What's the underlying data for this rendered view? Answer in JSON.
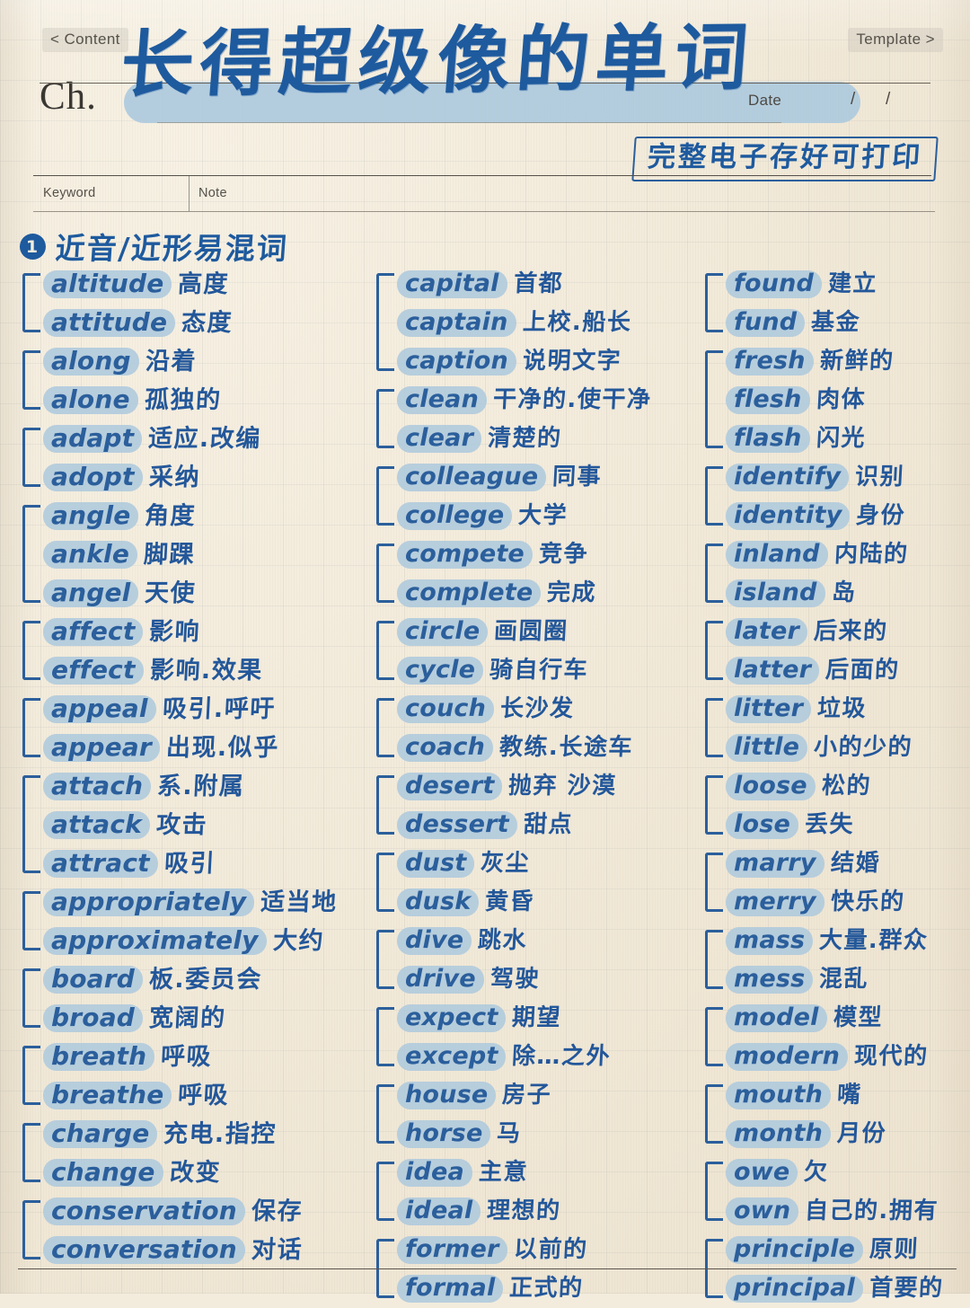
{
  "header": {
    "nav_prev": "< Content",
    "nav_next": "Template >",
    "chapter_label": "Ch.",
    "title": "长得超级像的单词",
    "date_label": "Date",
    "date_sep_1": "/",
    "date_sep_2": "/",
    "stamp": "完整电子存好可打印",
    "table_headers": {
      "keyword": "Keyword",
      "note": "Note"
    }
  },
  "section": {
    "number": "❶",
    "number_plain": "1",
    "heading": "近音/近形易混词"
  },
  "colors": {
    "paper": "#f3ecdd",
    "ink_blue": "#2b5f9c",
    "title_blue": "#1e5a9e",
    "highlight": "#aecadd",
    "rule_gray": "#55504a"
  },
  "columns": [
    {
      "id": "col-1",
      "groups": [
        {
          "items": [
            {
              "word": "altitude",
              "zh": "高度"
            },
            {
              "word": "attitude",
              "zh": "态度"
            }
          ]
        },
        {
          "items": [
            {
              "word": "along",
              "zh": "沿着"
            },
            {
              "word": "alone",
              "zh": "孤独的"
            }
          ]
        },
        {
          "items": [
            {
              "word": "adapt",
              "zh": "适应.改编"
            },
            {
              "word": "adopt",
              "zh": "采纳"
            }
          ]
        },
        {
          "items": [
            {
              "word": "angle",
              "zh": "角度"
            },
            {
              "word": "ankle",
              "zh": "脚踝"
            },
            {
              "word": "angel",
              "zh": "天使"
            }
          ]
        },
        {
          "items": [
            {
              "word": "affect",
              "zh": "影响"
            },
            {
              "word": "effect",
              "zh": "影响.效果"
            }
          ]
        },
        {
          "items": [
            {
              "word": "appeal",
              "zh": "吸引.呼吁"
            },
            {
              "word": "appear",
              "zh": "出现.似乎"
            }
          ]
        },
        {
          "items": [
            {
              "word": "attach",
              "zh": "系.附属"
            },
            {
              "word": "attack",
              "zh": "攻击"
            },
            {
              "word": "attract",
              "zh": "吸引"
            }
          ]
        },
        {
          "items": [
            {
              "word": "appropriately",
              "zh": "适当地"
            },
            {
              "word": "approximately",
              "zh": "大约"
            }
          ]
        },
        {
          "items": [
            {
              "word": "board",
              "zh": "板.委员会"
            },
            {
              "word": "broad",
              "zh": "宽阔的"
            }
          ]
        },
        {
          "items": [
            {
              "word": "breath",
              "zh": "呼吸"
            },
            {
              "word": "breathe",
              "zh": "呼吸"
            }
          ]
        },
        {
          "items": [
            {
              "word": "charge",
              "zh": "充电.指控"
            },
            {
              "word": "change",
              "zh": "改变"
            }
          ]
        },
        {
          "items": [
            {
              "word": "conservation",
              "zh": "保存"
            },
            {
              "word": "conversation",
              "zh": "对话"
            }
          ]
        }
      ]
    },
    {
      "id": "col-2",
      "groups": [
        {
          "items": [
            {
              "word": "capital",
              "zh": "首都"
            },
            {
              "word": "captain",
              "zh": "上校.船长"
            },
            {
              "word": "caption",
              "zh": "说明文字"
            }
          ]
        },
        {
          "items": [
            {
              "word": "clean",
              "zh": "干净的.使干净"
            },
            {
              "word": "clear",
              "zh": "清楚的"
            }
          ]
        },
        {
          "items": [
            {
              "word": "colleague",
              "zh": "同事"
            },
            {
              "word": "college",
              "zh": "大学"
            }
          ]
        },
        {
          "items": [
            {
              "word": "compete",
              "zh": "竞争"
            },
            {
              "word": "complete",
              "zh": "完成"
            }
          ]
        },
        {
          "items": [
            {
              "word": "circle",
              "zh": "画圆圈"
            },
            {
              "word": "cycle",
              "zh": "骑自行车"
            }
          ]
        },
        {
          "items": [
            {
              "word": "couch",
              "zh": "长沙发"
            },
            {
              "word": "coach",
              "zh": "教练.长途车"
            }
          ]
        },
        {
          "items": [
            {
              "word": "desert",
              "zh": "抛弃 沙漠"
            },
            {
              "word": "dessert",
              "zh": "甜点"
            }
          ]
        },
        {
          "items": [
            {
              "word": "dust",
              "zh": "灰尘"
            },
            {
              "word": "dusk",
              "zh": "黄昏"
            }
          ]
        },
        {
          "items": [
            {
              "word": "dive",
              "zh": "跳水"
            },
            {
              "word": "drive",
              "zh": "驾驶"
            }
          ]
        },
        {
          "items": [
            {
              "word": "expect",
              "zh": "期望"
            },
            {
              "word": "except",
              "zh": "除…之外"
            }
          ]
        },
        {
          "items": [
            {
              "word": "house",
              "zh": "房子"
            },
            {
              "word": "horse",
              "zh": "马"
            }
          ]
        },
        {
          "items": [
            {
              "word": "idea",
              "zh": "主意"
            },
            {
              "word": "ideal",
              "zh": "理想的"
            }
          ]
        },
        {
          "items": [
            {
              "word": "former",
              "zh": "以前的"
            },
            {
              "word": "formal",
              "zh": "正式的"
            }
          ]
        }
      ]
    },
    {
      "id": "col-3",
      "groups": [
        {
          "items": [
            {
              "word": "found",
              "zh": "建立"
            },
            {
              "word": "fund",
              "zh": "基金"
            }
          ]
        },
        {
          "items": [
            {
              "word": "fresh",
              "zh": "新鲜的"
            },
            {
              "word": "flesh",
              "zh": "肉体"
            },
            {
              "word": "flash",
              "zh": "闪光"
            }
          ]
        },
        {
          "items": [
            {
              "word": "identify",
              "zh": "识别"
            },
            {
              "word": "identity",
              "zh": "身份"
            }
          ]
        },
        {
          "items": [
            {
              "word": "inland",
              "zh": "内陆的"
            },
            {
              "word": "island",
              "zh": "岛"
            }
          ]
        },
        {
          "items": [
            {
              "word": "later",
              "zh": "后来的"
            },
            {
              "word": "latter",
              "zh": "后面的"
            }
          ]
        },
        {
          "items": [
            {
              "word": "litter",
              "zh": "垃圾"
            },
            {
              "word": "little",
              "zh": "小的少的"
            }
          ]
        },
        {
          "items": [
            {
              "word": "loose",
              "zh": "松的"
            },
            {
              "word": "lose",
              "zh": "丢失"
            }
          ]
        },
        {
          "items": [
            {
              "word": "marry",
              "zh": "结婚"
            },
            {
              "word": "merry",
              "zh": "快乐的"
            }
          ]
        },
        {
          "items": [
            {
              "word": "mass",
              "zh": "大量.群众"
            },
            {
              "word": "mess",
              "zh": "混乱"
            }
          ]
        },
        {
          "items": [
            {
              "word": "model",
              "zh": "模型"
            },
            {
              "word": "modern",
              "zh": "现代的"
            }
          ]
        },
        {
          "items": [
            {
              "word": "mouth",
              "zh": "嘴"
            },
            {
              "word": "month",
              "zh": "月份"
            }
          ]
        },
        {
          "items": [
            {
              "word": "owe",
              "zh": "欠"
            },
            {
              "word": "own",
              "zh": "自己的.拥有"
            }
          ]
        },
        {
          "items": [
            {
              "word": "principle",
              "zh": "原则"
            },
            {
              "word": "principal",
              "zh": "首要的"
            }
          ]
        }
      ]
    }
  ]
}
